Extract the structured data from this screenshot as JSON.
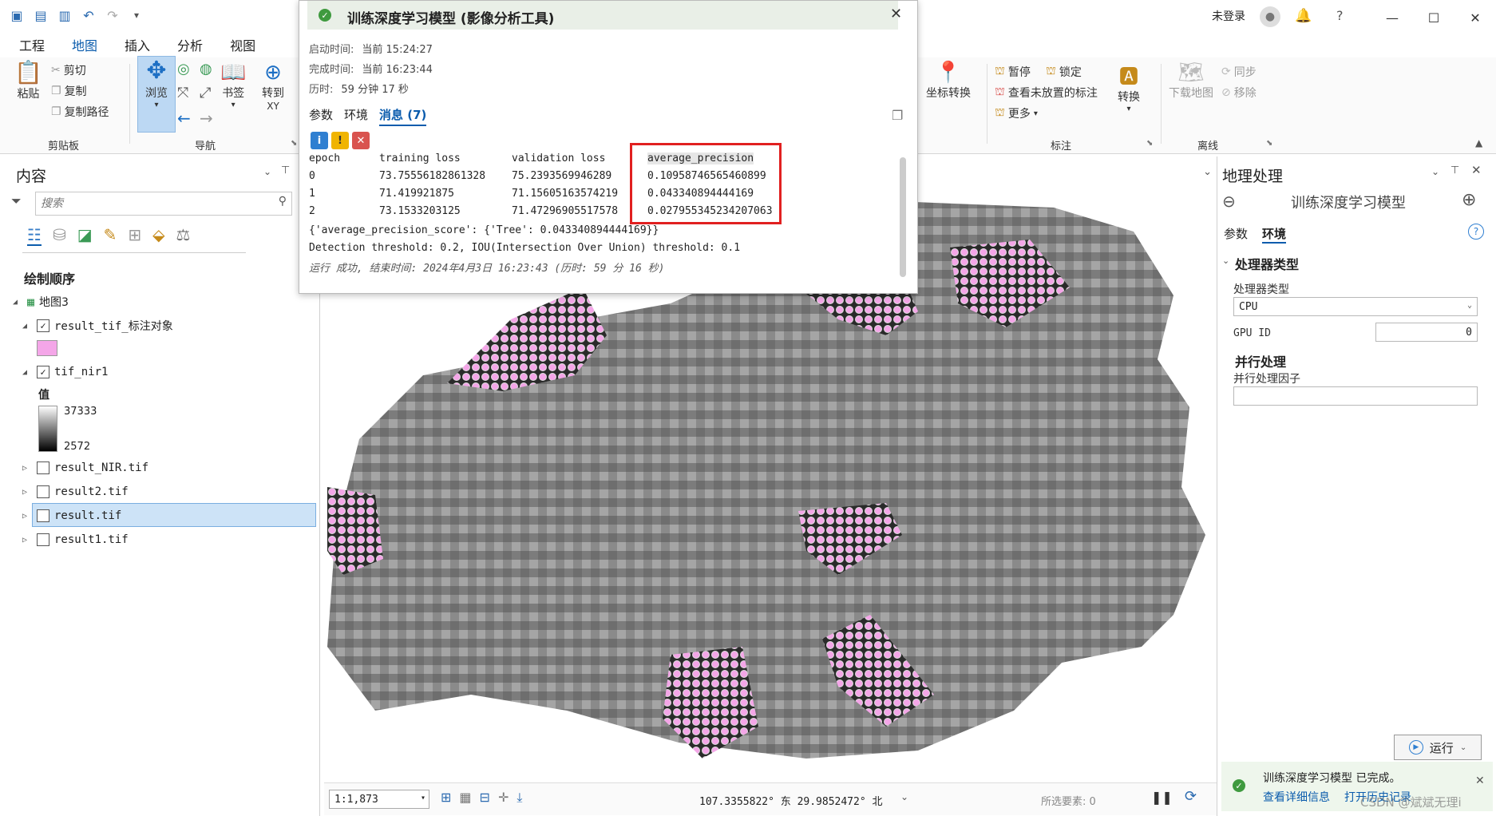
{
  "app": {
    "user": "未登录"
  },
  "ribbon": {
    "tabs": [
      "工程",
      "地图",
      "插入",
      "分析",
      "视图"
    ],
    "active_tab": "地图",
    "clipboard": {
      "paste": "粘贴",
      "cut": "剪切",
      "copy": "复制",
      "copy_path": "复制路径",
      "group": "剪贴板"
    },
    "navigate": {
      "browse": "浏览",
      "bookmark": "书签",
      "goto": "转到",
      "goto_sub": "XY",
      "group": "导航"
    },
    "labeling": {
      "convert_coord": "坐标转换",
      "pause": "暂停",
      "lock": "锁定",
      "view_unplaced": "查看未放置的标注",
      "more": "更多",
      "convert": "转换",
      "group": "标注"
    },
    "offline": {
      "download_map": "下载地图",
      "sync": "同步",
      "remove": "移除",
      "group": "离线"
    }
  },
  "contents": {
    "title": "内容",
    "search_placeholder": "搜索",
    "drawing_order": "绘制顺序",
    "map_name": "地图3",
    "layers": [
      {
        "name": "result_tif_标注对象",
        "checked": true,
        "expanded": true
      },
      {
        "name": "tif_nir1",
        "checked": true,
        "expanded": true
      },
      {
        "name": "result_NIR.tif",
        "checked": false,
        "expanded": false
      },
      {
        "name": "result2.tif",
        "checked": false,
        "expanded": false
      },
      {
        "name": "result.tif",
        "checked": false,
        "expanded": false,
        "selected": true
      },
      {
        "name": "result1.tif",
        "checked": false,
        "expanded": false
      }
    ],
    "value_label": "值",
    "value_max": "37333",
    "value_min": "2572",
    "symbol_color": "#f4a6e8"
  },
  "dialog": {
    "title": "训练深度学习模型 (影像分析工具)",
    "start_label": "启动时间:",
    "start_value": "当前 15:24:27",
    "end_label": "完成时间:",
    "end_value": "当前 16:23:44",
    "elapsed_label": "历时:",
    "elapsed_value": "59 分钟 17 秒",
    "tabs": [
      "参数",
      "环境",
      "消息 (7)"
    ],
    "active_tab": "消息 (7)",
    "table": {
      "headers": [
        "epoch",
        "training loss",
        "validation loss",
        "average_precision"
      ],
      "rows": [
        [
          "0",
          "73.75556182861328",
          "75.2393569946289",
          "0.10958746565460899"
        ],
        [
          "1",
          "71.419921875",
          "71.15605163574219",
          "0.043340894444169"
        ],
        [
          "2",
          "73.1533203125",
          "71.47296905517578",
          "0.027955345234207063"
        ]
      ]
    },
    "score_line": "{'average_precision_score': {'Tree': 0.043340894444169}}",
    "threshold_line": "Detection threshold: 0.2, IOU(Intersection Over Union) threshold: 0.1",
    "success_line": "运行 成功, 结束时间: 2024年4月3日 16:23:43 (历时: 59 分 16 秒)"
  },
  "geoprocessing": {
    "pane_title": "地理处理",
    "tool_title": "训练深度学习模型",
    "tabs": [
      "参数",
      "环境"
    ],
    "active_tab": "环境",
    "processor_section": "处理器类型",
    "processor_label": "处理器类型",
    "processor_value": "CPU",
    "gpu_label": "GPU ID",
    "gpu_value": "0",
    "parallel_section": "并行处理",
    "parallel_label": "并行处理因子",
    "run_label": "运行",
    "status_text": "训练深度学习模型 已完成。",
    "view_details": "查看详细信息",
    "open_history": "打开历史记录"
  },
  "map": {
    "scale": "1:1,873",
    "coords": "107.3355822° 东  29.9852472° 北",
    "selected_features": "所选要素: 0"
  },
  "watermark": "CSDN @斌斌无理i",
  "colors": {
    "accent": "#0b5cad",
    "highlight": "#e12020",
    "symbol": "#f4a6e8"
  }
}
